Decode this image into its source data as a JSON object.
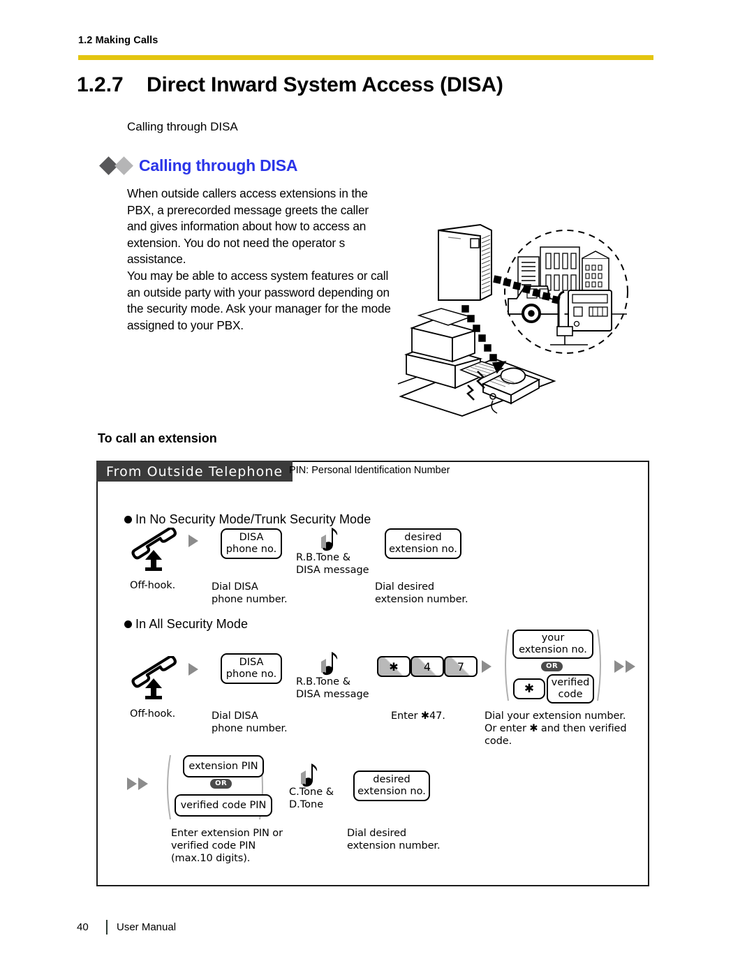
{
  "header": {
    "running_head": "1.2 Making Calls",
    "rule_color": "#e3c510"
  },
  "section": {
    "number": "1.2.7",
    "title": "Direct Inward System Access (DISA)",
    "subcaption": "Calling through DISA"
  },
  "feature": {
    "heading": "Calling through DISA",
    "heading_color": "#2b35e8",
    "paragraph1": "When outside callers access extensions in the PBX, a prerecorded message greets the caller and gives information about how to access an extension. You do not need the operator s assistance.",
    "paragraph2": "You may be able to access system features or call an outside party with your password depending on the security mode. Ask your manager for the mode assigned to your PBX."
  },
  "illustration": {
    "name": "disa-pbx-illustration",
    "elements": [
      "pbx-cabinet",
      "desktop-computer",
      "desk-telephone",
      "city-buildings",
      "car",
      "payphone",
      "dashed-circle"
    ]
  },
  "procedure": {
    "title": "To call an extension",
    "tab_label": "From Outside Telephone",
    "pin_note": "PIN: Personal Identification Number",
    "mode1": {
      "label": "In No Security Mode/Trunk Security Mode",
      "steps": [
        {
          "icon": "offhook-handset-icon",
          "caption": "Off-hook."
        },
        {
          "box": [
            "DISA",
            "phone no."
          ],
          "caption": "Dial DISA\nphone number."
        },
        {
          "tone": "R.B.Tone &\nDISA message"
        },
        {
          "box": [
            "desired",
            "extension no."
          ],
          "caption": "Dial desired\nextension number."
        }
      ]
    },
    "mode2": {
      "label": "In All Security Mode",
      "row1": {
        "offhook_caption": "Off-hook.",
        "disa_box": [
          "DISA",
          "phone no."
        ],
        "disa_caption": "Dial DISA\nphone number.",
        "tone": "R.B.Tone &\nDISA message",
        "keys": [
          "✱",
          "4",
          "7"
        ],
        "keys_caption": "Enter ✱47.",
        "choice": {
          "option1": [
            "your",
            "extension no."
          ],
          "or_label": "OR",
          "option2_key": "✱",
          "option2_box": [
            "verified",
            "code"
          ]
        },
        "choice_caption": "Dial your extension number.\nOr enter  ✱ and then verified\ncode."
      },
      "row2": {
        "choice": {
          "option1": "extension PIN",
          "or_label": "OR",
          "option2": "verified code PIN"
        },
        "choice_caption": "Enter extension PIN or\nverified code PIN\n(max.10 digits).",
        "tone": "C.Tone &\nD.Tone",
        "box": [
          "desired",
          "extension no."
        ],
        "box_caption": "Dial desired\nextension number."
      }
    }
  },
  "footer": {
    "page_number": "40",
    "label": "User Manual"
  }
}
